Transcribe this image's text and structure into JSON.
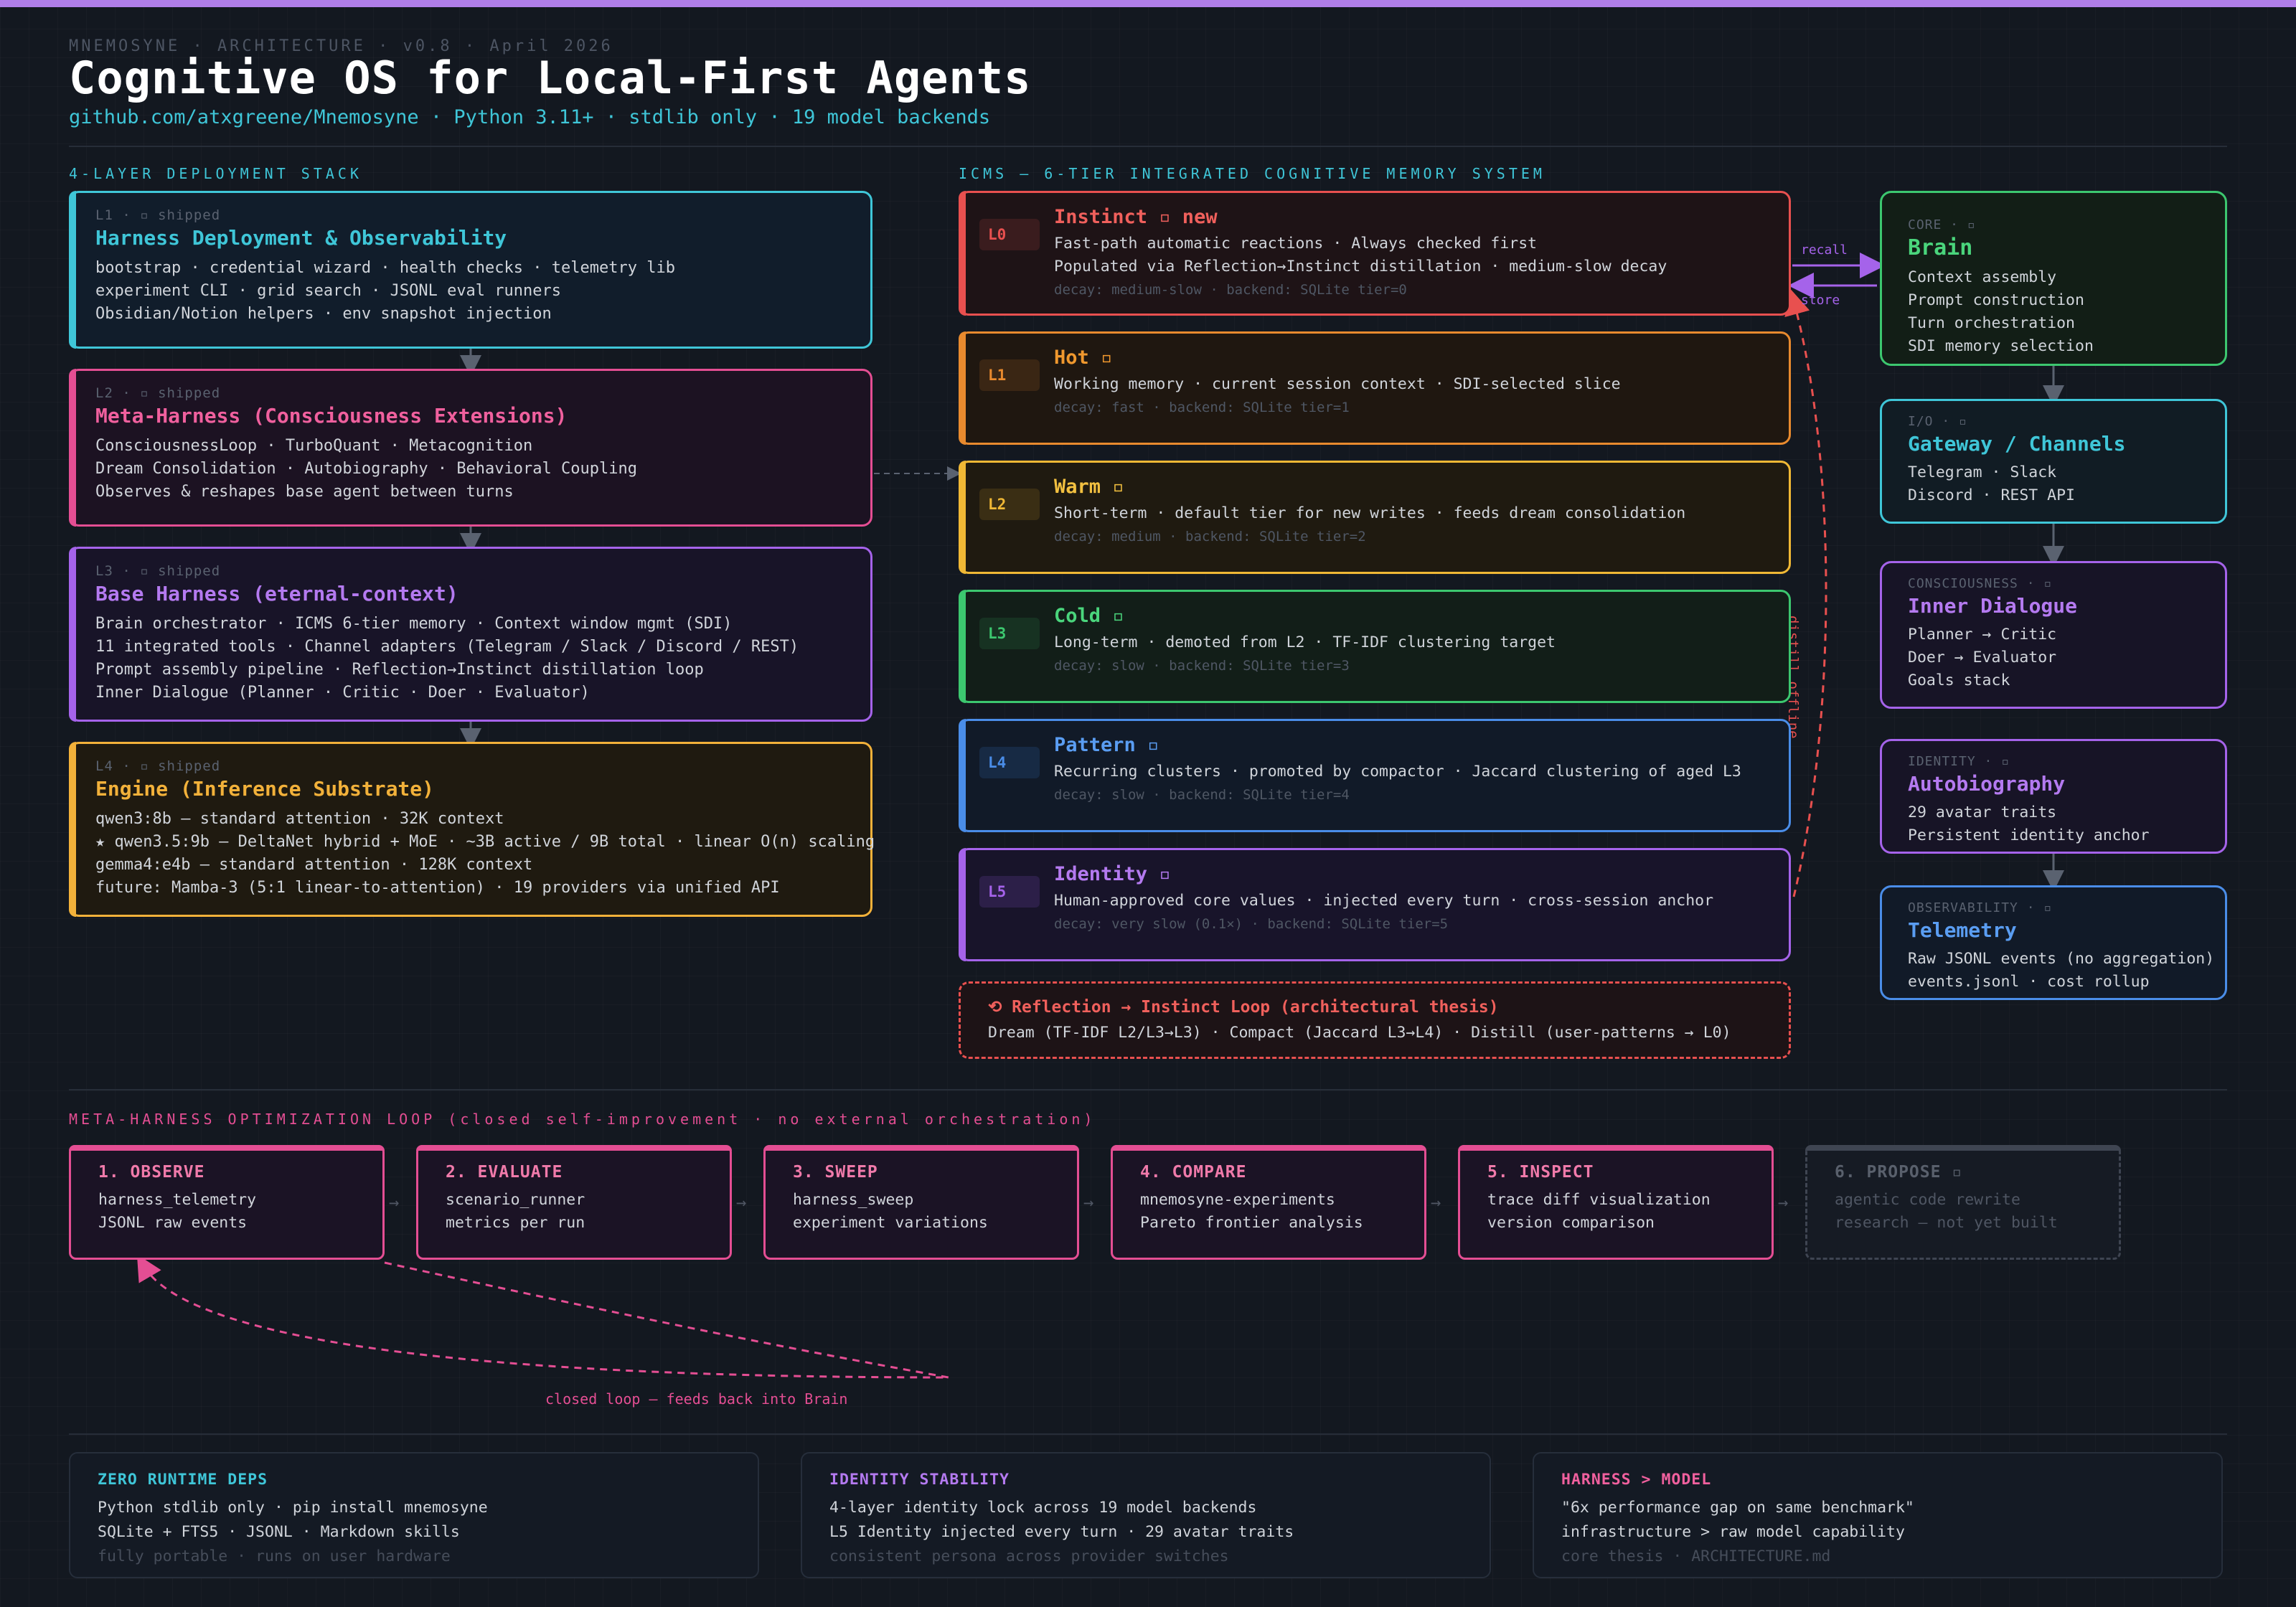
{
  "header": {
    "eyebrow": "MNEMOSYNE · ARCHITECTURE · v0.8 · April 2026",
    "title": "Cognitive OS for Local-First Agents",
    "subtitle": "github.com/atxgreene/Mnemosyne · Python 3.11+ · stdlib only · 19 model backends"
  },
  "colors": {
    "cyan": "#3fc6d8",
    "pink": "#e44e93",
    "purple": "#a563ea",
    "amber": "#f2b13a",
    "red": "#e8504f",
    "orange": "#e88a2e",
    "yellow": "#f0b835",
    "green": "#3cc76f",
    "blue": "#4a8de8",
    "violet": "#a563ea"
  },
  "stack": {
    "label": "4-LAYER DEPLOYMENT STACK",
    "layers": [
      {
        "tag": "L1 · ▫ shipped",
        "name": "Harness Deployment & Observability",
        "lines": [
          "bootstrap · credential wizard · health checks · telemetry lib",
          "experiment CLI · grid search · JSONL eval runners",
          "Obsidian/Notion helpers · env snapshot injection"
        ]
      },
      {
        "tag": "L2 · ▫ shipped",
        "name": "Meta-Harness (Consciousness Extensions)",
        "lines": [
          "ConsciousnessLoop · TurboQuant · Metacognition",
          "Dream Consolidation · Autobiography · Behavioral Coupling",
          "Observes & reshapes base agent between turns"
        ]
      },
      {
        "tag": "L3 · ▫ shipped",
        "name": "Base Harness (eternal-context)",
        "lines": [
          "Brain orchestrator · ICMS 6-tier memory · Context window mgmt (SDI)",
          "11 integrated tools · Channel adapters (Telegram / Slack / Discord / REST)",
          "Prompt assembly pipeline · Reflection→Instinct distillation loop",
          "Inner Dialogue (Planner · Critic · Doer · Evaluator)"
        ]
      },
      {
        "tag": "L4 · ▫ shipped",
        "name": "Engine (Inference Substrate)",
        "lines": [
          "qwen3:8b — standard attention · 32K context",
          "★ qwen3.5:9b — DeltaNet hybrid + MoE · ~3B active / 9B total · linear O(n) scaling",
          "gemma4:e4b — standard attention · 128K context",
          "future: Mamba-3 (5:1 linear-to-attention) · 19 providers via unified API"
        ]
      }
    ]
  },
  "icms": {
    "label": "ICMS — 6-TIER INTEGRATED COGNITIVE MEMORY SYSTEM",
    "tiers": [
      {
        "badge": "L0",
        "name": "Instinct ▫ new",
        "lines": [
          "Fast-path automatic reactions · Always checked first",
          "Populated via Reflection→Instinct distillation · medium-slow decay"
        ],
        "decay": "decay: medium-slow · backend: SQLite tier=0"
      },
      {
        "badge": "L1",
        "name": "Hot ▫",
        "lines": [
          "Working memory · current session context · SDI-selected slice"
        ],
        "decay": "decay: fast · backend: SQLite tier=1"
      },
      {
        "badge": "L2",
        "name": "Warm ▫",
        "lines": [
          "Short-term · default tier for new writes · feeds dream consolidation"
        ],
        "decay": "decay: medium · backend: SQLite tier=2"
      },
      {
        "badge": "L3",
        "name": "Cold ▫",
        "lines": [
          "Long-term · demoted from L2 · TF-IDF clustering target"
        ],
        "decay": "decay: slow · backend: SQLite tier=3"
      },
      {
        "badge": "L4",
        "name": "Pattern ▫",
        "lines": [
          "Recurring clusters · promoted by compactor · Jaccard clustering of aged L3"
        ],
        "decay": "decay: slow · backend: SQLite tier=4"
      },
      {
        "badge": "L5",
        "name": "Identity ▫",
        "lines": [
          "Human-approved core values · injected every turn · cross-session anchor"
        ],
        "decay": "decay: very slow (0.1×) · backend: SQLite tier=5"
      }
    ],
    "reflection": {
      "title": "⟲ Reflection → Instinct Loop (architectural thesis)",
      "line": "Dream (TF-IDF L2/L3→L3) · Compact (Jaccard L3→L4) · Distill (user-patterns → L0)"
    },
    "recall_label": "recall",
    "store_label": "store",
    "distill_label": "distill offline"
  },
  "components": [
    {
      "tag": "CORE · ▫",
      "name": "Brain",
      "lines": [
        "Context assembly",
        "Prompt construction",
        "Turn orchestration",
        "SDI memory selection"
      ]
    },
    {
      "tag": "I/O · ▫",
      "name": "Gateway / Channels",
      "lines": [
        "Telegram · Slack",
        "Discord · REST API"
      ]
    },
    {
      "tag": "CONSCIOUSNESS · ▫",
      "name": "Inner Dialogue",
      "lines": [
        "Planner → Critic",
        "Doer → Evaluator",
        "Goals stack"
      ]
    },
    {
      "tag": "IDENTITY · ▫",
      "name": "Autobiography",
      "lines": [
        "29 avatar traits",
        "Persistent identity anchor"
      ]
    },
    {
      "tag": "OBSERVABILITY · ▫",
      "name": "Telemetry",
      "lines": [
        "Raw JSONL events (no aggregation)",
        "events.jsonl · cost rollup"
      ]
    }
  ],
  "loop": {
    "label": "META-HARNESS OPTIMIZATION LOOP (closed self-improvement · no external orchestration)",
    "steps": [
      {
        "name": "1. OBSERVE",
        "lines": [
          "harness_telemetry",
          "JSONL raw events"
        ]
      },
      {
        "name": "2. EVALUATE",
        "lines": [
          "scenario_runner",
          "metrics per run"
        ]
      },
      {
        "name": "3. SWEEP",
        "lines": [
          "harness_sweep",
          "experiment variations"
        ]
      },
      {
        "name": "4. COMPARE",
        "lines": [
          "mnemosyne-experiments",
          "Pareto frontier analysis"
        ]
      },
      {
        "name": "5. INSPECT",
        "lines": [
          "trace diff visualization",
          "version comparison"
        ]
      },
      {
        "name": "6. PROPOSE ▫",
        "lines": [
          "agentic code rewrite",
          "research — not yet built"
        ]
      }
    ],
    "arrow": "→",
    "closed_loop_label": "closed loop — feeds back into Brain"
  },
  "footer": [
    {
      "heading": "ZERO RUNTIME DEPS",
      "lines": [
        "Python stdlib only · pip install mnemosyne",
        "SQLite + FTS5 · JSONL · Markdown skills"
      ],
      "muted": "fully portable · runs on user hardware"
    },
    {
      "heading": "IDENTITY STABILITY",
      "lines": [
        "4-layer identity lock across 19 model backends",
        "L5 Identity injected every turn · 29 avatar traits"
      ],
      "muted": "consistent persona across provider switches"
    },
    {
      "heading": "HARNESS > MODEL",
      "lines": [
        "\"6x performance gap on same benchmark\"",
        "infrastructure > raw model capability"
      ],
      "muted": "core thesis · ARCHITECTURE.md"
    }
  ]
}
